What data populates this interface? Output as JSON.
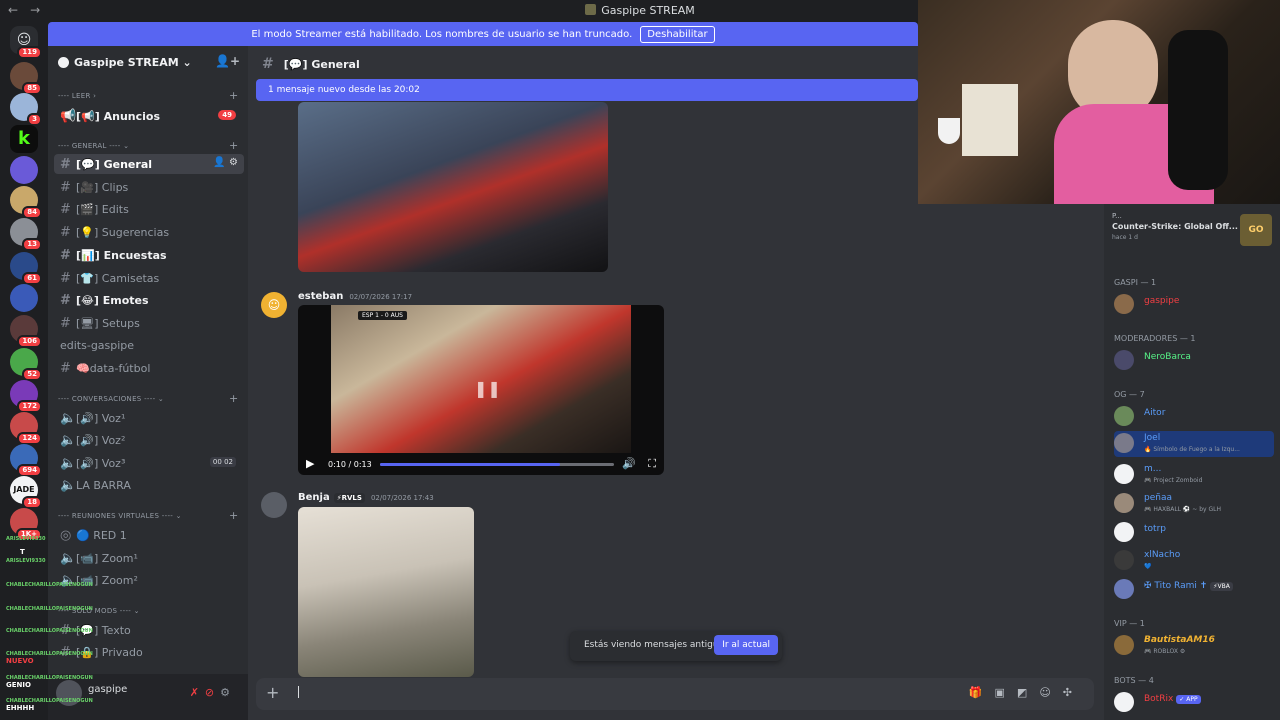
{
  "window": {
    "title": "Gaspipe STREAM",
    "nav_back": "←",
    "nav_fwd": "→"
  },
  "streamer_banner": {
    "text": "El modo Streamer está habilitado. Los nombres de usuario se han truncado.",
    "button": "Deshabilitar"
  },
  "server_rail": {
    "home_badge": "119",
    "badges": [
      "85",
      "3",
      "",
      "84",
      "13",
      "61",
      "",
      "106",
      "52",
      "172",
      "124",
      "694",
      "18",
      "1K+"
    ]
  },
  "server": {
    "name": "Gaspipe STREAM"
  },
  "categories": {
    "leer": "LEER",
    "general": "GENERAL",
    "conversaciones": "CONVERSACIONES",
    "reuniones": "REUNIONES VIRTUALES",
    "solo_mods": "SOLO MODS"
  },
  "channels": [
    {
      "name": "Anuncios",
      "prefix": "[📢]",
      "badge": "49"
    },
    {
      "name": "General",
      "prefix": "[💬]"
    },
    {
      "name": "Clips",
      "prefix": "[🎥]"
    },
    {
      "name": "Edits",
      "prefix": "[🎬]"
    },
    {
      "name": "Sugerencias",
      "prefix": "[💡]"
    },
    {
      "name": "Encuestas",
      "prefix": "[📊]"
    },
    {
      "name": "Camisetas",
      "prefix": "[👕]"
    },
    {
      "name": "Emotes",
      "prefix": "[😂]"
    },
    {
      "name": "Setups",
      "prefix": "[🖥]"
    },
    {
      "name": "edits-gaspipe"
    },
    {
      "name": "data-fútbol",
      "prefix": "🧠"
    }
  ],
  "voice_channels": [
    {
      "name": "Voz¹",
      "prefix": "[🔊]"
    },
    {
      "name": "Voz²",
      "prefix": "[🔊]"
    },
    {
      "name": "Voz³",
      "prefix": "[🔊]",
      "counter_a": "00",
      "counter_b": "02"
    },
    {
      "name": "LA BARRA"
    }
  ],
  "meeting_channels": [
    {
      "name": "RED 1",
      "prefix": "🔵"
    },
    {
      "name": "Zoom¹",
      "prefix": "[📹]"
    },
    {
      "name": "Zoom²",
      "prefix": "[📹]"
    }
  ],
  "mod_channels": [
    {
      "name": "Texto",
      "prefix": "[💬]"
    },
    {
      "name": "Privado",
      "prefix": "[🔒]"
    }
  ],
  "user_panel": {
    "name": "gaspipe"
  },
  "chat_overlay": {
    "names": [
      "ARISLEVI9330",
      "ARISLEVI9330",
      "CHABLECHARILLOPAISENOGUN",
      "CHABLECHARILLOPAISENOGUN",
      "CHABLECHARILLOPAISENOGUN",
      "CHABLECHARILLOPAISENOGUN",
      "CHABLECHARILLOPAISENOGUN",
      "CHABLECHARILLOPAISENOGUN"
    ],
    "messages": [
      "T",
      "NUEVO",
      "GENIO",
      "EHHHH"
    ]
  },
  "channel_header": {
    "name": "General",
    "prefix": "[💬]"
  },
  "new_messages_bar": "1 mensaje nuevo desde las 20:02",
  "messages": [
    {
      "author": "esteban",
      "timestamp": "02/07/2026 17:17",
      "video": {
        "time": "0:10 / 0:13",
        "progress": 0.77,
        "overlay": "ESP 1 - 0 AUS"
      }
    },
    {
      "author": "Benja",
      "tag": "⚡RVLS",
      "timestamp": "02/07/2026 17:43"
    }
  ],
  "old_messages": {
    "text": "Estás viendo mensajes antiguos",
    "button": "Ir al actual"
  },
  "activity": {
    "title": "P...",
    "game": "Counter-Strike: Global Off...",
    "ago": "hace 1 d",
    "icon": "GO"
  },
  "member_groups": [
    {
      "label": "GASPI — 1",
      "members": [
        {
          "name": "gaspipe",
          "color": "#f23f43"
        }
      ]
    },
    {
      "label": "MODERADORES — 1",
      "members": [
        {
          "name": "NeroBarca",
          "color": "#57f287"
        }
      ]
    },
    {
      "label": "OG — 7",
      "members": [
        {
          "name": "Aitor",
          "color": "#5a9cf8"
        },
        {
          "name": "Joel",
          "color": "#5a9cf8",
          "status": "🔥 Símbolo de Fuego a la Izqu..."
        },
        {
          "name": "m...",
          "color": "#5a9cf8",
          "status": "🎮 Project Zomboid"
        },
        {
          "name": "peñaa",
          "color": "#5a9cf8",
          "status": "🎮 HAXBALL ⚽ ~ by GLH"
        },
        {
          "name": "totrp",
          "color": "#5a9cf8"
        },
        {
          "name": "xlNacho",
          "color": "#5a9cf8",
          "status": "💙"
        },
        {
          "name": "✠ Tito Rami ✝",
          "color": "#5a9cf8",
          "tag": "⚡VBA"
        }
      ]
    },
    {
      "label": "VIP — 1",
      "members": [
        {
          "name": "BautistaAM16",
          "color": "#f0b232",
          "status": "🎮 ROBLOX ⚙"
        }
      ]
    },
    {
      "label": "BOTS — 4",
      "members": [
        {
          "name": "BotRix",
          "color": "#f23f43",
          "tag": "✓ APP"
        }
      ]
    }
  ],
  "colors": {
    "accent": "#5865f2",
    "sidebar": "#2b2d31",
    "main": "#313338",
    "rail": "#1e1f22",
    "danger": "#f23f43"
  }
}
